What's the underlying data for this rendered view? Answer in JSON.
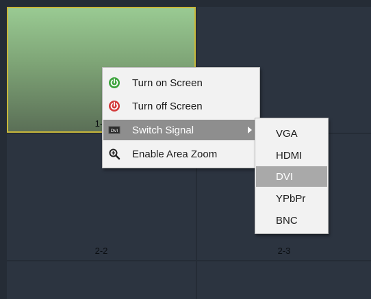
{
  "grid": {
    "cells": [
      {
        "id": "1-1",
        "label": "1-1",
        "selected": true
      },
      {
        "id": "1-2",
        "label": "",
        "selected": false
      },
      {
        "id": "2-2",
        "label": "2-2",
        "selected": false
      },
      {
        "id": "2-3",
        "label": "2-3",
        "selected": false
      }
    ],
    "selected_color": "#7ea476",
    "selected_border": "#c9b83a",
    "cell_color": "#2c3440"
  },
  "context_menu": {
    "items": [
      {
        "label": "Turn on Screen",
        "icon": "power-on-icon",
        "icon_color": "#3ea43e"
      },
      {
        "label": "Turn off Screen",
        "icon": "power-off-icon",
        "icon_color": "#d33a3a"
      },
      {
        "label": "Switch Signal",
        "icon": "dvi-icon",
        "active": true,
        "has_submenu": true
      },
      {
        "label": "Enable Area Zoom",
        "icon": "zoom-in-icon"
      }
    ]
  },
  "signal_submenu": {
    "items": [
      {
        "label": "VGA"
      },
      {
        "label": "HDMI"
      },
      {
        "label": "DVI",
        "highlighted": true
      },
      {
        "label": "YPbPr"
      },
      {
        "label": "BNC"
      }
    ]
  }
}
